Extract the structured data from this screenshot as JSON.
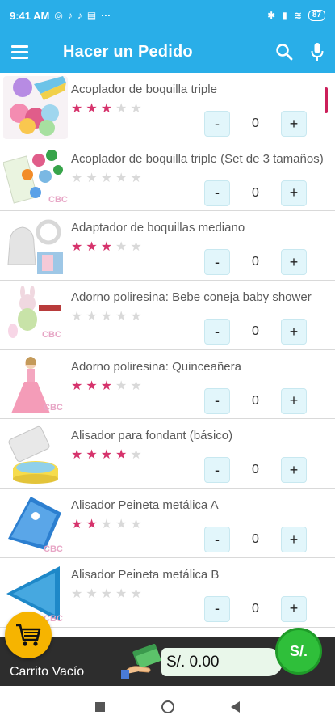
{
  "status_bar": {
    "time": "9:41 AM",
    "battery": "87",
    "more": "···"
  },
  "app_bar": {
    "title": "Hacer un Pedido"
  },
  "products": [
    {
      "name": "Acoplador de boquilla triple",
      "rating": 3,
      "qty": "0"
    },
    {
      "name": "Acoplador de boquilla triple (Set de 3 tamaños)",
      "rating": 0,
      "qty": "0"
    },
    {
      "name": "Adaptador de boquillas mediano",
      "rating": 3,
      "qty": "0"
    },
    {
      "name": "Adorno poliresina: Bebe coneja baby shower",
      "rating": 0,
      "qty": "0"
    },
    {
      "name": "Adorno poliresina: Quinceañera",
      "rating": 3,
      "qty": "0"
    },
    {
      "name": "Alisador para fondant (básico)",
      "rating": 4,
      "qty": "0"
    },
    {
      "name": "Alisador Peineta metálica A",
      "rating": 2,
      "qty": "0"
    },
    {
      "name": "Alisador Peineta metálica B",
      "rating": 0,
      "qty": "0"
    }
  ],
  "stepper": {
    "minus": "-",
    "plus": "+"
  },
  "cart": {
    "label": "Carrito Vacío",
    "total": "S/. 0.00",
    "checkout_label": "S/."
  },
  "colors": {
    "primary": "#29aee8",
    "star_on": "#d6336c",
    "cart": "#f6b400",
    "checkout": "#2fbf3a"
  }
}
